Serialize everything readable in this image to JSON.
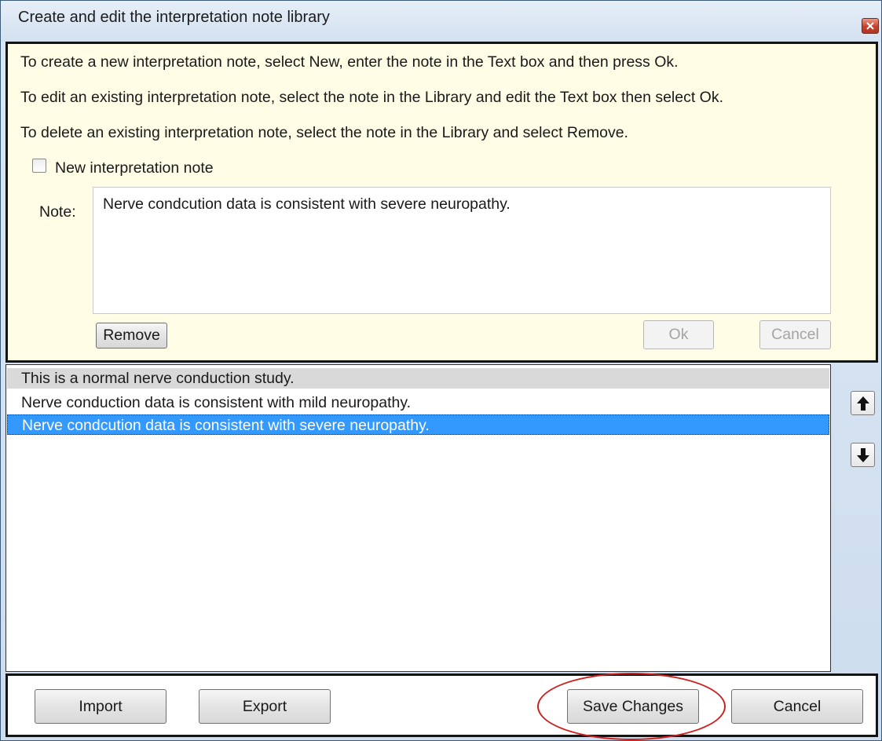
{
  "window": {
    "title": "Create and edit the interpretation note library"
  },
  "help": {
    "lines": [
      "To create a new interpretation note, select New, enter the note in the Text box and then press Ok.",
      "To edit an existing interpretation note, select the note in the Library and edit the Text box then select Ok.",
      "To delete an existing interpretation note, select the note in the Library and select Remove."
    ],
    "new_note_checkbox_label": "New interpretation note",
    "new_note_checked": false
  },
  "editor": {
    "note_label": "Note:",
    "note_text": "Nerve condcution data is consistent with severe neuropathy.",
    "remove_label": "Remove",
    "ok_label": "Ok",
    "cancel_label": "Cancel"
  },
  "library": {
    "items": [
      "This is a normal nerve conduction study.",
      "Nerve conduction data is consistent with mild neuropathy.",
      "Nerve condcution data is consistent with severe neuropathy."
    ],
    "selected_index": 2,
    "hover_index": 0
  },
  "footer": {
    "import_label": "Import",
    "export_label": "Export",
    "save_label": "Save Changes",
    "cancel_label": "Cancel"
  },
  "colors": {
    "help_background": "#fffde6",
    "selection": "#3399ff",
    "annotation": "#cc1f1f"
  }
}
